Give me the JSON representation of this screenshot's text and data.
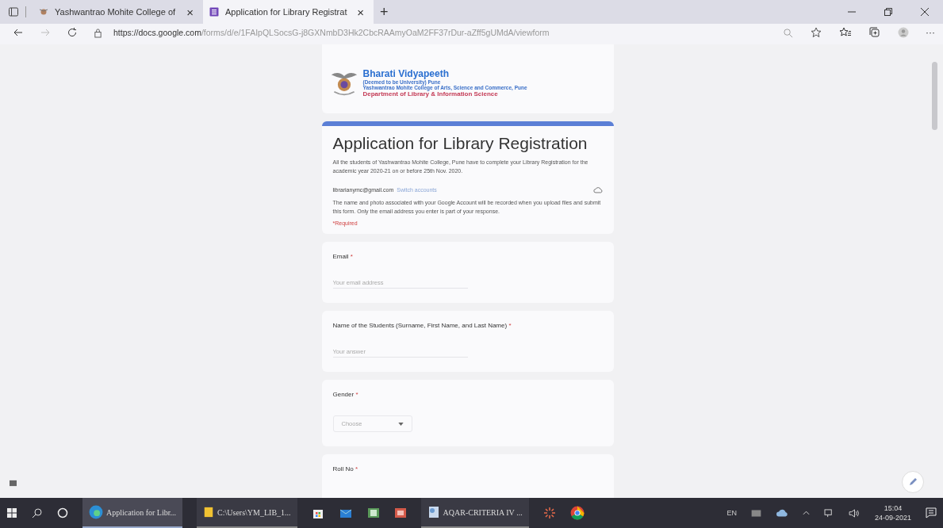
{
  "browser": {
    "tabs": [
      {
        "title": "Yashwantrao Mohite College of",
        "close": "×",
        "selected": false
      },
      {
        "title": "Application for Library Registrat",
        "close": "×",
        "selected": true
      }
    ],
    "new_tab": "+",
    "url_host": "https://docs.google.com",
    "url_path": "/forms/d/e/1FAIpQLSocsG-j8GXNmbD3Hk2CbcRAAmyOaM2FF37rDur-aZff5gUMdA/viewform",
    "more": "···"
  },
  "form": {
    "banner": {
      "title": "Bharati Vidyapeeth",
      "subtitle": "(Deemed to be University) Pune",
      "college": "Yashwantrao Mohite College of Arts, Science and Commerce, Pune",
      "department": "Department of Library & Information Science"
    },
    "title": "Application for Library Registration",
    "description": "All the students of Yashwantrao Mohite College, Pune have to complete your Library Registration for the academic year 2020-21  on or before 25th Nov. 2020.",
    "account_email": "librarianymc@gmail.com",
    "switch_link": "Switch accounts",
    "notice": "The name and photo associated with your Google Account will be recorded when you upload files and submit this form. Only the email address you enter is part of your response.",
    "required_note": "*Required",
    "questions": [
      {
        "kind": "text",
        "label": "Email",
        "required_mark": "*",
        "placeholder": "Your email address"
      },
      {
        "kind": "text",
        "label": "Name of the Students (Surname, First Name, and Last Name)",
        "required_mark": "*",
        "placeholder": "Your answer"
      },
      {
        "kind": "dropdown",
        "label": "Gender",
        "required_mark": "*",
        "placeholder": "Choose"
      },
      {
        "kind": "text",
        "label": "Roll No",
        "required_mark": "*"
      }
    ]
  },
  "taskbar": {
    "items": [
      {
        "kind": "browser",
        "label": "Application for Libr..."
      },
      {
        "kind": "folder",
        "label": "C:\\Users\\YM_LIB_1..."
      },
      {
        "kind": "store"
      },
      {
        "kind": "mail"
      },
      {
        "kind": "sheet"
      },
      {
        "kind": "slides"
      },
      {
        "kind": "document",
        "label": "AQAR-CRITERIA IV ..."
      },
      {
        "kind": "spinner"
      },
      {
        "kind": "chrome"
      }
    ],
    "language": "EN",
    "time": "15:04",
    "date": "24-09-2021"
  }
}
